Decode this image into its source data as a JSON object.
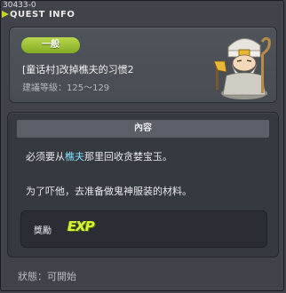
{
  "window": {
    "quest_id": "30433-0",
    "title": "QUEST INFO"
  },
  "quest": {
    "category_badge": "一般",
    "name": "[童话村]改掉樵夫的习惯2",
    "level_label": "建議等級：",
    "level_range": "125～129"
  },
  "content": {
    "header": "內容",
    "line1_prefix": "必须要从",
    "line1_highlight": "樵夫",
    "line1_suffix": "那里回收贪婪宝玉。",
    "line2": "为了吓他，去准备做鬼神服装的材料。"
  },
  "reward": {
    "label": "獎勵",
    "exp_text": "EXP"
  },
  "status": {
    "label": "狀態：",
    "value": "可開始"
  },
  "colors": {
    "badge": "#9cc436",
    "highlight": "#7fe3ff",
    "exp": "#d8f33a"
  }
}
